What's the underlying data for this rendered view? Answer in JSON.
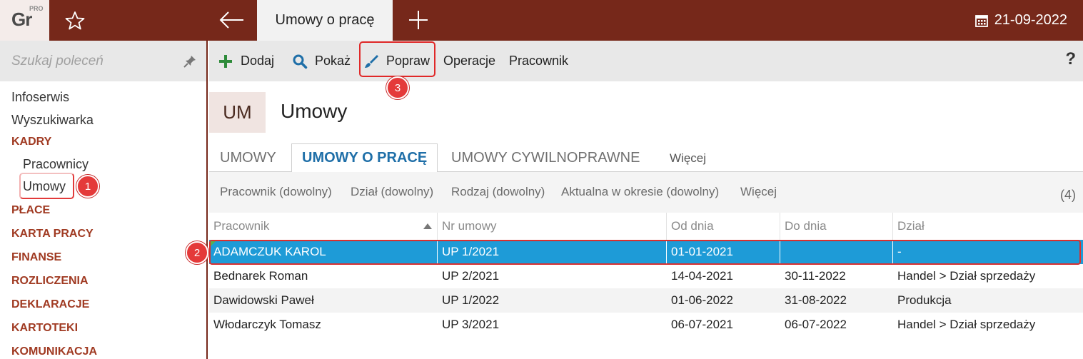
{
  "app": {
    "logo_main": "Gr",
    "logo_sup": "PRO"
  },
  "topbar": {
    "active_tab": "Umowy o pracę",
    "date": "21-09-2022"
  },
  "sidebar": {
    "search_placeholder": "Szukaj poleceń",
    "items": {
      "infoserwis": "Infoserwis",
      "wyszukiwarka": "Wyszukiwarka",
      "kadry": "KADRY",
      "pracownicy": "Pracownicy",
      "umowy": "Umowy",
      "place": "PŁACE",
      "karta_pracy": "KARTA PRACY",
      "finanse": "FINANSE",
      "rozliczenia": "ROZLICZENIA",
      "deklaracje": "DEKLARACJE",
      "kartoteki": "KARTOTEKI",
      "komunikacja": "KOMUNIKACJA"
    }
  },
  "toolbar": {
    "dodaj": "Dodaj",
    "pokaz": "Pokaż",
    "popraw": "Popraw",
    "operacje": "Operacje",
    "pracownik": "Pracownik",
    "help": "?"
  },
  "badges": {
    "b1": "1",
    "b2": "2",
    "b3": "3"
  },
  "module": {
    "code": "UM",
    "title": "Umowy"
  },
  "tabs": {
    "umowy": "UMOWY",
    "umowy_o_prace": "UMOWY O PRACĘ",
    "umowy_cywilnoprawne": "UMOWY CYWILNOPRAWNE",
    "wiecej": "Więcej"
  },
  "filters": {
    "pracownik": "Pracownik (dowolny)",
    "dzial": "Dział (dowolny)",
    "rodzaj": "Rodzaj (dowolny)",
    "aktualna": "Aktualna w okresie (dowolny)",
    "wiecej": "Więcej",
    "count": "(4)"
  },
  "table": {
    "headers": {
      "pracownik": "Pracownik",
      "nr_umowy": "Nr umowy",
      "od_dnia": "Od dnia",
      "do_dnia": "Do dnia",
      "dzial": "Dział"
    },
    "rows": [
      {
        "pracownik": "ADAMCZUK KAROL",
        "nr": "UP 1/2021",
        "od": "01-01-2021",
        "do": "",
        "dzial": "-"
      },
      {
        "pracownik": "Bednarek Roman",
        "nr": "UP 2/2021",
        "od": "14-04-2021",
        "do": "30-11-2022",
        "dzial": "Handel > Dział sprzedaży"
      },
      {
        "pracownik": "Dawidowski Paweł",
        "nr": "UP 1/2022",
        "od": "01-06-2022",
        "do": "31-08-2022",
        "dzial": "Produkcja"
      },
      {
        "pracownik": "Włodarczyk Tomasz",
        "nr": "UP 3/2021",
        "od": "06-07-2021",
        "do": "06-07-2022",
        "dzial": "Handel > Dział sprzedaży"
      }
    ]
  }
}
